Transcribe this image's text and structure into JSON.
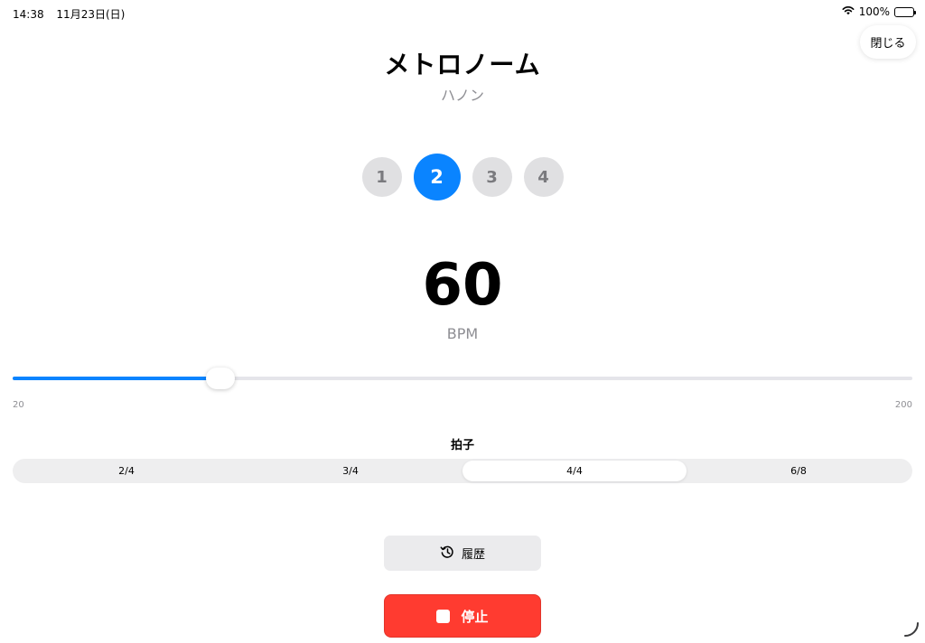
{
  "status_bar": {
    "time": "14:38",
    "date": "11月23日(日)",
    "battery": "100%",
    "icons": [
      "wifi-icon",
      "battery-icon"
    ]
  },
  "close_label": "閉じる",
  "title": "メトロノーム",
  "subtitle": "ハノン",
  "beats": [
    "1",
    "2",
    "3",
    "4"
  ],
  "active_beat": "2",
  "bpm": {
    "value": "60",
    "unit": "BPM",
    "min": "20",
    "max": "200"
  },
  "time_signature": {
    "label": "拍子",
    "options": [
      "2/4",
      "3/4",
      "4/4",
      "6/8"
    ],
    "selected": "4/4"
  },
  "history_label": "履歴",
  "stop_label": "停止",
  "colors": {
    "accent": "#0a84ff",
    "stop": "#ff3b30"
  }
}
